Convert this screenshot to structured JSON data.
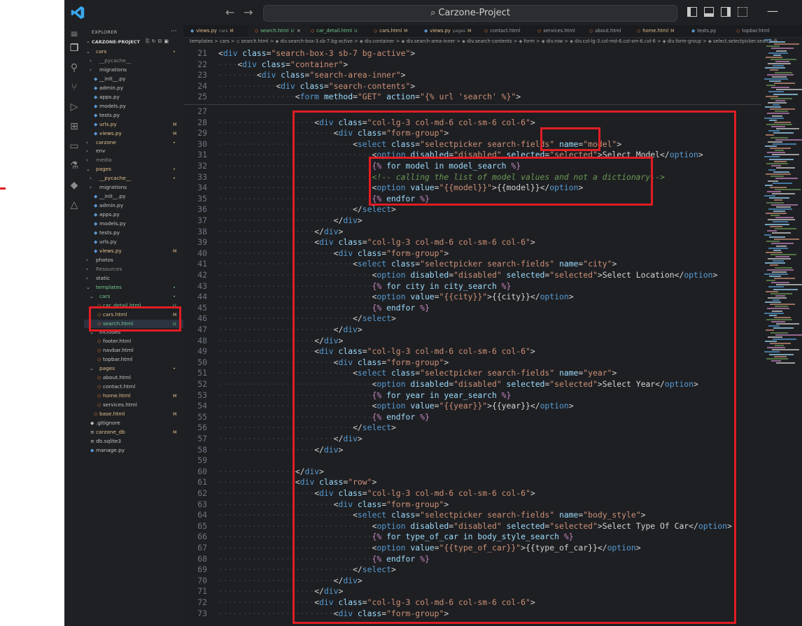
{
  "window": {
    "search_text": "Carzone-Project",
    "back_arrow": "←",
    "forward_arrow": "→"
  },
  "activity_icons": [
    "menu-icon",
    "files-icon",
    "search-icon",
    "source-control-icon",
    "run-debug-icon",
    "extensions-icon",
    "remote-explorer-icon",
    "testing-icon",
    "docker-icon",
    "azure-icon"
  ],
  "explorer": {
    "title": "EXPLORER",
    "more": "···",
    "project": "CARZONE-PROJECT",
    "items": [
      {
        "label": "cars",
        "kind": "folder",
        "open": true,
        "indent": 1,
        "badge": "•",
        "color": "#e2c08d"
      },
      {
        "label": "__pycache__",
        "kind": "folder",
        "open": false,
        "indent": 2,
        "badge": "",
        "color": "#8b8b8b"
      },
      {
        "label": "migrations",
        "kind": "folder",
        "open": false,
        "indent": 2,
        "badge": "",
        "color": "#c5c5c5"
      },
      {
        "label": "__init__.py",
        "kind": "py",
        "indent": 2,
        "badge": "",
        "color": "#c5c5c5"
      },
      {
        "label": "admin.py",
        "kind": "py",
        "indent": 2,
        "badge": "",
        "color": "#c5c5c5"
      },
      {
        "label": "apps.py",
        "kind": "py",
        "indent": 2,
        "badge": "",
        "color": "#c5c5c5"
      },
      {
        "label": "models.py",
        "kind": "py",
        "indent": 2,
        "badge": "",
        "color": "#c5c5c5"
      },
      {
        "label": "tests.py",
        "kind": "py",
        "indent": 2,
        "badge": "",
        "color": "#c5c5c5"
      },
      {
        "label": "urls.py",
        "kind": "py",
        "indent": 2,
        "badge": "M",
        "color": "#e2c08d"
      },
      {
        "label": "views.py",
        "kind": "py",
        "indent": 2,
        "badge": "M",
        "color": "#e2c08d"
      },
      {
        "label": "carzone",
        "kind": "folder",
        "open": false,
        "indent": 1,
        "badge": "•",
        "color": "#e2c08d"
      },
      {
        "label": "env",
        "kind": "folder",
        "open": false,
        "indent": 1,
        "badge": "",
        "color": "#c5c5c5"
      },
      {
        "label": "media",
        "kind": "folder",
        "open": false,
        "indent": 1,
        "badge": "",
        "color": "#8b8b8b"
      },
      {
        "label": "pages",
        "kind": "folder",
        "open": true,
        "indent": 1,
        "badge": "•",
        "color": "#e2c08d"
      },
      {
        "label": "__pycache__",
        "kind": "folder",
        "open": false,
        "indent": 2,
        "badge": "•",
        "color": "#e2c08d"
      },
      {
        "label": "migrations",
        "kind": "folder",
        "open": false,
        "indent": 2,
        "badge": "",
        "color": "#c5c5c5"
      },
      {
        "label": "__init__.py",
        "kind": "py",
        "indent": 2,
        "badge": "",
        "color": "#c5c5c5"
      },
      {
        "label": "admin.py",
        "kind": "py",
        "indent": 2,
        "badge": "",
        "color": "#c5c5c5"
      },
      {
        "label": "apps.py",
        "kind": "py",
        "indent": 2,
        "badge": "",
        "color": "#c5c5c5"
      },
      {
        "label": "models.py",
        "kind": "py",
        "indent": 2,
        "badge": "",
        "color": "#c5c5c5"
      },
      {
        "label": "tests.py",
        "kind": "py",
        "indent": 2,
        "badge": "",
        "color": "#c5c5c5"
      },
      {
        "label": "urls.py",
        "kind": "py",
        "indent": 2,
        "badge": "",
        "color": "#c5c5c5"
      },
      {
        "label": "views.py",
        "kind": "py",
        "indent": 2,
        "badge": "M",
        "color": "#e2c08d"
      },
      {
        "label": "photos",
        "kind": "folder",
        "open": false,
        "indent": 1,
        "badge": "",
        "color": "#c5c5c5"
      },
      {
        "label": "Resources",
        "kind": "folder",
        "open": false,
        "indent": 1,
        "badge": "",
        "color": "#8b8b8b"
      },
      {
        "label": "static",
        "kind": "folder",
        "open": false,
        "indent": 1,
        "badge": "",
        "color": "#c5c5c5"
      },
      {
        "label": "templates",
        "kind": "folder",
        "open": true,
        "indent": 1,
        "badge": "•",
        "color": "#73c991"
      },
      {
        "label": "cars",
        "kind": "folder",
        "open": true,
        "indent": 2,
        "badge": "•",
        "color": "#73c991"
      },
      {
        "label": "car_detail.html",
        "kind": "html",
        "indent": 3,
        "badge": "U",
        "color": "#73c991"
      },
      {
        "label": "cars.html",
        "kind": "html",
        "indent": 3,
        "badge": "M",
        "color": "#e2c08d"
      },
      {
        "label": "search.html",
        "kind": "html",
        "indent": 3,
        "badge": "U",
        "color": "#73c991",
        "selected": true
      },
      {
        "label": "includes",
        "kind": "folder",
        "open": true,
        "indent": 2,
        "badge": "",
        "color": "#c5c5c5"
      },
      {
        "label": "footer.html",
        "kind": "html",
        "indent": 3,
        "badge": "",
        "color": "#c5c5c5"
      },
      {
        "label": "navbar.html",
        "kind": "html",
        "indent": 3,
        "badge": "",
        "color": "#c5c5c5"
      },
      {
        "label": "topbar.html",
        "kind": "html",
        "indent": 3,
        "badge": "",
        "color": "#c5c5c5"
      },
      {
        "label": "pages",
        "kind": "folder",
        "open": true,
        "indent": 2,
        "badge": "•",
        "color": "#e2c08d"
      },
      {
        "label": "about.html",
        "kind": "html",
        "indent": 3,
        "badge": "",
        "color": "#c5c5c5"
      },
      {
        "label": "contact.html",
        "kind": "html",
        "indent": 3,
        "badge": "",
        "color": "#c5c5c5"
      },
      {
        "label": "home.html",
        "kind": "html",
        "indent": 3,
        "badge": "M",
        "color": "#e2c08d"
      },
      {
        "label": "services.html",
        "kind": "html",
        "indent": 3,
        "badge": "",
        "color": "#c5c5c5"
      },
      {
        "label": "base.html",
        "kind": "html",
        "indent": 2,
        "badge": "M",
        "color": "#e2c08d"
      },
      {
        "label": ".gitignore",
        "kind": "git",
        "indent": 1,
        "badge": "",
        "color": "#c5c5c5"
      },
      {
        "label": "carzone_db",
        "kind": "db",
        "indent": 1,
        "badge": "M",
        "color": "#e2c08d"
      },
      {
        "label": "db.sqlite3",
        "kind": "db",
        "indent": 1,
        "badge": "",
        "color": "#c5c5c5"
      },
      {
        "label": "manage.py",
        "kind": "py",
        "indent": 1,
        "badge": "",
        "color": "#c5c5c5"
      }
    ]
  },
  "tabs": [
    {
      "label": "views.py",
      "sub": "cars",
      "badge": "M",
      "kind": "py",
      "color": "#e2c08d"
    },
    {
      "label": "search.html",
      "sub": "",
      "badge": "U",
      "kind": "html",
      "color": "#73c991",
      "active": true,
      "close": "×"
    },
    {
      "label": "car_detail.html",
      "sub": "",
      "badge": "U",
      "kind": "html",
      "color": "#73c991"
    },
    {
      "label": "cars.html",
      "sub": "",
      "badge": "M",
      "kind": "html",
      "color": "#e2c08d"
    },
    {
      "label": "views.py",
      "sub": "pages",
      "badge": "M",
      "kind": "py",
      "color": "#e2c08d"
    },
    {
      "label": "contact.html",
      "sub": "",
      "badge": "",
      "kind": "html",
      "color": "#9ea0a5"
    },
    {
      "label": "services.html",
      "sub": "",
      "badge": "",
      "kind": "html",
      "color": "#9ea0a5"
    },
    {
      "label": "about.html",
      "sub": "",
      "badge": "",
      "kind": "html",
      "color": "#9ea0a5"
    },
    {
      "label": "home.html",
      "sub": "",
      "badge": "M",
      "kind": "html",
      "color": "#e2c08d"
    },
    {
      "label": "tests.py",
      "sub": "",
      "badge": "",
      "kind": "py",
      "color": "#9ea0a5"
    },
    {
      "label": "topbar.html",
      "sub": "",
      "badge": "",
      "kind": "html",
      "color": "#9ea0a5"
    }
  ],
  "breadcrumb": "templates > cars > ◇ search.html > ◈ div.search-box-3.sb-7.bg-active > ◈ div.container > ◈ div.search-area-inner > ◈ div.search-contents > ◈ form > ◈ div.row > ◈ div.col-lg-3.col-md-6.col-sm-6.col-6 > ◈ div.form-group > ◈ select.selectpicker.search-fi",
  "sticky_lines": [
    {
      "n": "21",
      "text": "<div class=\"search-box-3 sb-7 bg-active\">"
    },
    {
      "n": "22",
      "text": "    <div class=\"container\">"
    },
    {
      "n": "23",
      "text": "        <div class=\"search-area-inner\">"
    },
    {
      "n": "24",
      "text": "            <div class=\"search-contents\">"
    },
    {
      "n": "25",
      "text": "                <form method=\"GET\" action=\"{% url 'search' %}\">"
    }
  ],
  "code_lines": [
    {
      "n": "27",
      "text": ""
    },
    {
      "n": "28",
      "text": "                    <div class=\"col-lg-3 col-md-6 col-sm-6 col-6\">"
    },
    {
      "n": "29",
      "text": "                        <div class=\"form-group\">"
    },
    {
      "n": "30",
      "text": "                            <select class=\"selectpicker search-fields\" name=\"model\">"
    },
    {
      "n": "31",
      "text": "                                <option disabled=\"disabled\" selected=\"selected\">Select Model</option>"
    },
    {
      "n": "32",
      "text": "                                {% for model in model_search %}"
    },
    {
      "n": "33",
      "text": "                                <!-- calling the list of model values and not a dictionary-->"
    },
    {
      "n": "34",
      "text": "                                <option value=\"{{model}}\">{{model}}</option>"
    },
    {
      "n": "35",
      "text": "                                {% endfor %}"
    },
    {
      "n": "36",
      "text": "                            </select>"
    },
    {
      "n": "37",
      "text": "                        </div>"
    },
    {
      "n": "38",
      "text": "                    </div>"
    },
    {
      "n": "39",
      "text": "                    <div class=\"col-lg-3 col-md-6 col-sm-6 col-6\">"
    },
    {
      "n": "40",
      "text": "                        <div class=\"form-group\">"
    },
    {
      "n": "41",
      "text": "                            <select class=\"selectpicker search-fields\" name=\"city\">"
    },
    {
      "n": "42",
      "text": "                                <option disabled=\"disabled\" selected=\"selected\">Select Location</option>"
    },
    {
      "n": "43",
      "text": "                                {% for city in city_search %}"
    },
    {
      "n": "44",
      "text": "                                <option value=\"{{city}}\">{{city}}</option>"
    },
    {
      "n": "45",
      "text": "                                {% endfor %}"
    },
    {
      "n": "46",
      "text": "                            </select>"
    },
    {
      "n": "47",
      "text": "                        </div>"
    },
    {
      "n": "48",
      "text": "                    </div>"
    },
    {
      "n": "49",
      "text": "                    <div class=\"col-lg-3 col-md-6 col-sm-6 col-6\">"
    },
    {
      "n": "50",
      "text": "                        <div class=\"form-group\">"
    },
    {
      "n": "51",
      "text": "                            <select class=\"selectpicker search-fields\" name=\"year\">"
    },
    {
      "n": "52",
      "text": "                                <option disabled=\"disabled\" selected=\"selected\">Select Year</option>"
    },
    {
      "n": "53",
      "text": "                                {% for year in year_search %}"
    },
    {
      "n": "54",
      "text": "                                <option value=\"{{year}}\">{{year}}</option>"
    },
    {
      "n": "55",
      "text": "                                {% endfor %}"
    },
    {
      "n": "56",
      "text": "                            </select>"
    },
    {
      "n": "57",
      "text": "                        </div>"
    },
    {
      "n": "58",
      "text": "                    </div>"
    },
    {
      "n": "59",
      "text": ""
    },
    {
      "n": "60",
      "text": "                </div>"
    },
    {
      "n": "61",
      "text": "                <div class=\"row\">"
    },
    {
      "n": "62",
      "text": "                    <div class=\"col-lg-3 col-md-6 col-sm-6 col-6\">"
    },
    {
      "n": "63",
      "text": "                        <div class=\"form-group\">"
    },
    {
      "n": "64",
      "text": "                            <select class=\"selectpicker search-fields\" name=\"body_style\">"
    },
    {
      "n": "65",
      "text": "                                <option disabled=\"disabled\" selected=\"selected\">Select Type Of Car</option>"
    },
    {
      "n": "66",
      "text": "                                {% for type_of_car in body_style_search %}"
    },
    {
      "n": "67",
      "text": "                                <option value=\"{{type_of_car}}\">{{type_of_car}}</option>"
    },
    {
      "n": "68",
      "text": "                                {% endfor %}"
    },
    {
      "n": "69",
      "text": "                            </select>"
    },
    {
      "n": "70",
      "text": "                        </div>"
    },
    {
      "n": "71",
      "text": "                    </div>"
    },
    {
      "n": "72",
      "text": "                    <div class=\"col-lg-3 col-md-6 col-sm-6 col-6\">"
    },
    {
      "n": "73",
      "text": "                        <div class=\"form-group\">"
    }
  ],
  "colors": {
    "highlight_red": "#e11d24",
    "tag": "#569cd6",
    "attr": "#9cdcfe",
    "string": "#ce9178",
    "django": "#c586c0",
    "comment": "#6a9955"
  }
}
